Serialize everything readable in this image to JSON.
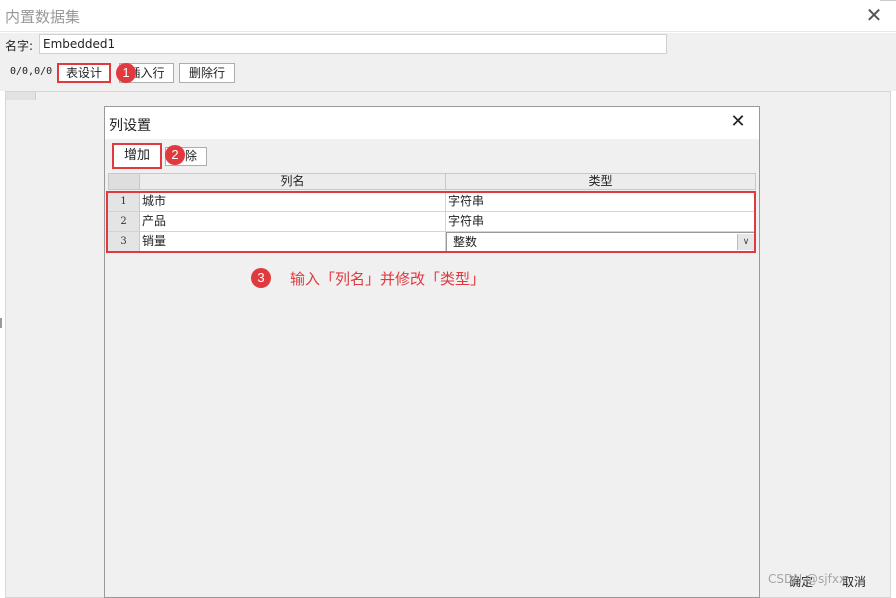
{
  "outer_dialog": {
    "title": "内置数据集",
    "close_glyph": "✕",
    "name_label": "名字:",
    "name_value": "Embedded1",
    "position_text": "0/0,0/0",
    "toolbar": {
      "table_design": "表设计",
      "insert_row": "插入行",
      "delete_row": "删除行"
    },
    "ok_label": "确定",
    "cancel_label": "取消"
  },
  "inner_dialog": {
    "title": "列设置",
    "close_glyph": "✕",
    "add_label": "增加",
    "remove_label": "除",
    "headers": {
      "col_name": "列名",
      "col_type": "类型"
    },
    "rows": [
      {
        "num": "1",
        "name": "城市",
        "type": "字符串"
      },
      {
        "num": "2",
        "name": "产品",
        "type": "字符串"
      },
      {
        "num": "3",
        "name": "销量",
        "type": "整数"
      }
    ],
    "dropdown_glyph": "∨"
  },
  "annotations": {
    "badge_1": "1",
    "badge_2": "2",
    "badge_3": "3",
    "step3_text": "输入「列名」并修改「类型」",
    "accent_color": "#e0393e"
  },
  "watermark": "CSDN @sjfxx"
}
